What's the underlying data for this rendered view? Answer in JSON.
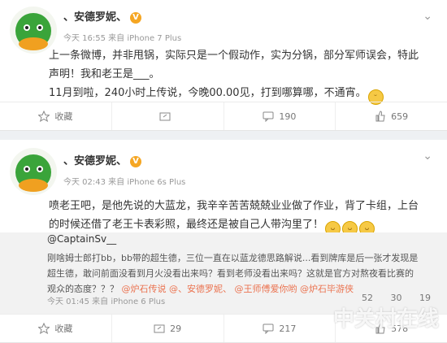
{
  "post1": {
    "username": "、安德罗妮、",
    "verified_badge": "V",
    "meta": "今天 16:55 来自 iPhone 7 Plus",
    "text_lines": [
      "上一条微博，并非甩锅，实际只是一个假动作，实为分锅，部分军师误会，特此",
      "声明！我和老王是___。",
      "11月到啦，240小时上传说，今晚00.00见，打到哪算哪，不通宵。"
    ],
    "actions": {
      "fav": "收藏",
      "share": "",
      "comments": "190",
      "likes": "659"
    }
  },
  "post2": {
    "username": "、安德罗妮、",
    "verified_badge": "V",
    "meta": "今天 02:43 来自 iPhone 6s Plus",
    "text_lines": [
      "喷老王吧，是他先说的大蓝龙，我辛辛苦苦兢兢业业做了作业，背了卡组，上台",
      "的时候还借了老王卡表彩照，最终还是被自己人带沟里了！"
    ],
    "quote": {
      "user": "@CaptainSv__",
      "lines": [
        "刚啥姆士郎打bb，bb带的超生德，三位一直在以蓝龙德思路解说...看到牌库是后一张才发现是",
        "超生德，敢问前面没看到月火没看出来吗？看到老师没看出来吗？这就是官方对熬夜看比赛的",
        "观众的态度？？？"
      ],
      "tags": [
        "@炉石传说",
        "@、安德罗妮、",
        "@王师傅爱你哟",
        "@炉石毕游侠"
      ],
      "meta": "今天 01:45 来自 iPhone 6 Plus",
      "stats": {
        "reposts": "52",
        "comments": "30",
        "likes": "19"
      }
    },
    "actions": {
      "fav": "收藏",
      "reposts": "29",
      "comments": "217",
      "likes": "578"
    }
  },
  "watermark": "中关村在线"
}
